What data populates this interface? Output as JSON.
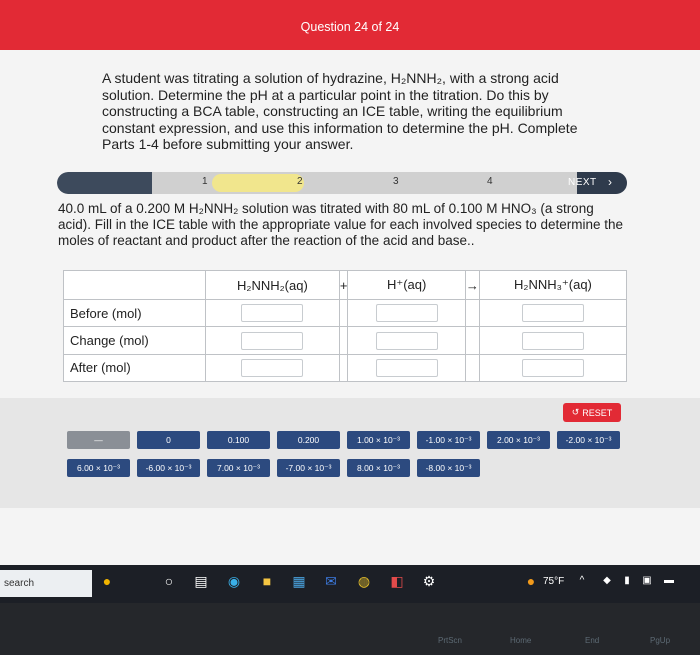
{
  "header": {
    "title": "Question 24 of 24"
  },
  "prompt": "A student was titrating a solution of hydrazine, H₂NNH₂, with a strong acid solution. Determine the pH at a particular point in the titration. Do this by constructing a BCA table, constructing an ICE table, writing the equilibrium constant expression, and use this information to determine the pH. Complete Parts 1-4 before submitting your answer.",
  "progress": {
    "steps": [
      "1",
      "2",
      "3",
      "4"
    ],
    "active_step": 1,
    "next_label": "NEXT",
    "next_arrow": "›"
  },
  "question": "40.0 mL of a 0.200 M H₂NNH₂ solution was titrated with 80 mL of 0.100 M HNO₃ (a strong acid). Fill in the ICE table with the appropriate value for each involved species to determine the moles of reactant and product after the reaction of the acid and base..",
  "table": {
    "species": [
      "H₂NNH₂(aq)",
      "H⁺(aq)",
      "H₂NNH₃⁺(aq)"
    ],
    "operators": [
      "+",
      "→"
    ],
    "rows": [
      "Before (mol)",
      "Change (mol)",
      "After (mol)"
    ]
  },
  "tiles": {
    "row1": [
      "—",
      "0",
      "0.100",
      "0.200",
      "1.00 × 10⁻³",
      "-1.00 × 10⁻³",
      "2.00 × 10⁻³",
      "-2.00 × 10⁻³"
    ],
    "row2": [
      "6.00 × 10⁻³",
      "-6.00 × 10⁻³",
      "7.00 × 10⁻³",
      "-7.00 × 10⁻³",
      "8.00 × 10⁻³",
      "-8.00 × 10⁻³"
    ]
  },
  "reset_label": "RESET",
  "taskbar": {
    "search": "search",
    "weather": "75°F"
  },
  "keyboard": [
    "PrtScn",
    "Home",
    "End",
    "PgUp"
  ],
  "colors": {
    "header": "#e22a35",
    "tile": "#2c4a7f",
    "progress_done": "#3d4a5c",
    "active_step": "#f1e68d"
  }
}
